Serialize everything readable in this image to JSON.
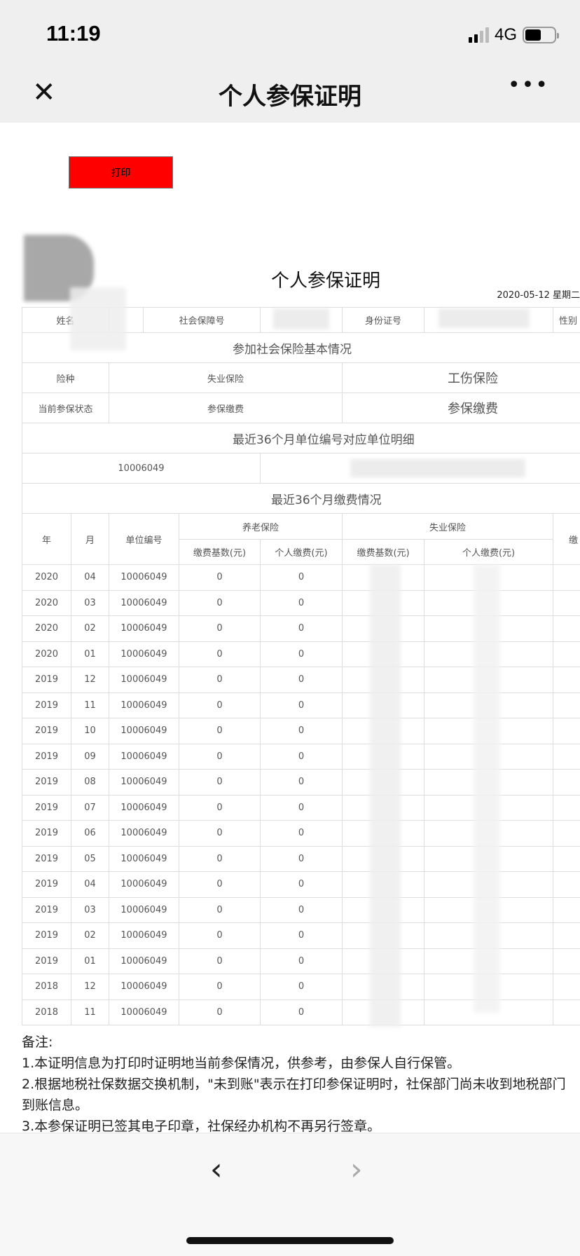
{
  "status_bar": {
    "time": "11:19",
    "network": "4G"
  },
  "nav": {
    "title": "个人参保证明",
    "close_icon": "✕",
    "more_icon": "•••"
  },
  "print_button": "打印",
  "doc": {
    "title": "个人参保证明",
    "date": "2020-05-12 星期二",
    "info_labels": {
      "name": "姓名",
      "ss_no": "社会保障号",
      "id_no": "身份证号",
      "gender": "性别"
    },
    "basic_section": "参加社会保险基本情况",
    "insurance_type_label": "险种",
    "insurance_types": [
      "失业保险",
      "工伤保险"
    ],
    "status_label": "当前参保状态",
    "statuses": [
      "参保缴费",
      "参保缴费"
    ],
    "unit_section": "最近36个月单位编号对应单位明细",
    "unit_no": "10006049",
    "payment_section": "最近36个月缴费情况",
    "headers": {
      "year": "年",
      "month": "月",
      "unit_no": "单位编号",
      "pension": "养老保险",
      "unemployment": "失业保险",
      "base": "缴费基数(元)",
      "personal": "个人缴费(元)",
      "last": "缴"
    },
    "rows": [
      {
        "year": "2020",
        "month": "04",
        "unit": "10006049",
        "p_base": "0",
        "p_personal": "0"
      },
      {
        "year": "2020",
        "month": "03",
        "unit": "10006049",
        "p_base": "0",
        "p_personal": "0"
      },
      {
        "year": "2020",
        "month": "02",
        "unit": "10006049",
        "p_base": "0",
        "p_personal": "0"
      },
      {
        "year": "2020",
        "month": "01",
        "unit": "10006049",
        "p_base": "0",
        "p_personal": "0"
      },
      {
        "year": "2019",
        "month": "12",
        "unit": "10006049",
        "p_base": "0",
        "p_personal": "0"
      },
      {
        "year": "2019",
        "month": "11",
        "unit": "10006049",
        "p_base": "0",
        "p_personal": "0"
      },
      {
        "year": "2019",
        "month": "10",
        "unit": "10006049",
        "p_base": "0",
        "p_personal": "0"
      },
      {
        "year": "2019",
        "month": "09",
        "unit": "10006049",
        "p_base": "0",
        "p_personal": "0"
      },
      {
        "year": "2019",
        "month": "08",
        "unit": "10006049",
        "p_base": "0",
        "p_personal": "0"
      },
      {
        "year": "2019",
        "month": "07",
        "unit": "10006049",
        "p_base": "0",
        "p_personal": "0"
      },
      {
        "year": "2019",
        "month": "06",
        "unit": "10006049",
        "p_base": "0",
        "p_personal": "0"
      },
      {
        "year": "2019",
        "month": "05",
        "unit": "10006049",
        "p_base": "0",
        "p_personal": "0"
      },
      {
        "year": "2019",
        "month": "04",
        "unit": "10006049",
        "p_base": "0",
        "p_personal": "0"
      },
      {
        "year": "2019",
        "month": "03",
        "unit": "10006049",
        "p_base": "0",
        "p_personal": "0"
      },
      {
        "year": "2019",
        "month": "02",
        "unit": "10006049",
        "p_base": "0",
        "p_personal": "0"
      },
      {
        "year": "2019",
        "month": "01",
        "unit": "10006049",
        "p_base": "0",
        "p_personal": "0"
      },
      {
        "year": "2018",
        "month": "12",
        "unit": "10006049",
        "p_base": "0",
        "p_personal": "0"
      },
      {
        "year": "2018",
        "month": "11",
        "unit": "10006049",
        "p_base": "0",
        "p_personal": "0"
      }
    ],
    "notes": {
      "heading": "备注:",
      "n1": "1.本证明信息为打印时证明地当前参保情况，供参考，由参保人自行保管。",
      "n2a": "2.根据地税社保数据交换机制，\"未到账\"表示在打印参保证明时，社保部门尚未收到地税部门",
      "n2b": "到账信息。",
      "n3": "3.本参保证明已签其电子印章，社保经办机构不再另行签章。"
    }
  },
  "bottom_nav": {
    "back_icon": "‹",
    "forward_icon": "›"
  }
}
